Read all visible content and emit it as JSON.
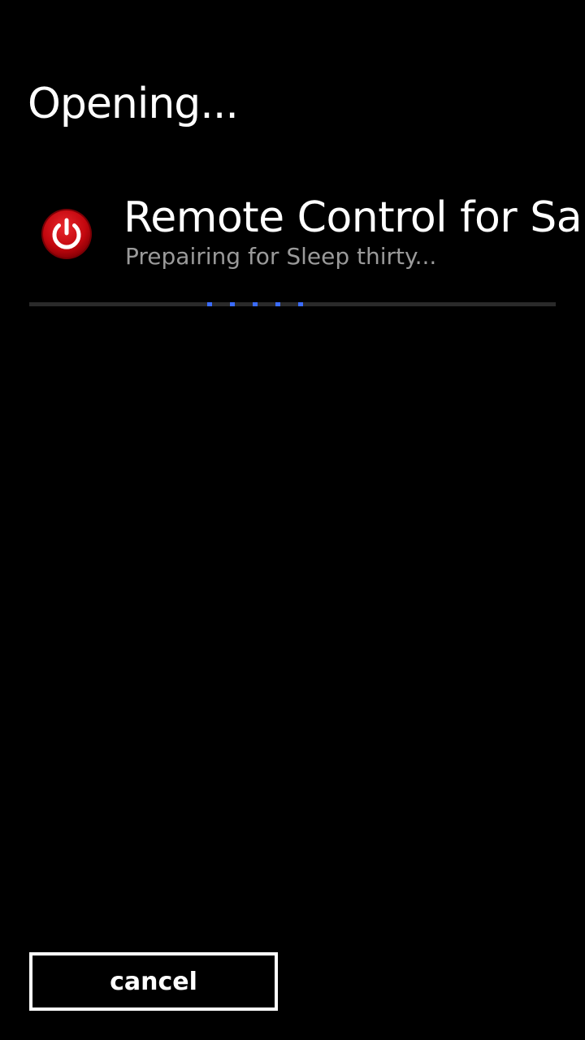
{
  "header": {
    "title": "Opening..."
  },
  "app": {
    "name": "Remote Control for Sam",
    "status": "Prepairing for Sleep thirty...",
    "icon": "power-icon",
    "icon_color": "#c8000a"
  },
  "progress": {
    "style": "indeterminate",
    "dot_color": "#3b6cff",
    "track_color": "#2a2a2a"
  },
  "footer": {
    "cancel_label": "cancel"
  }
}
